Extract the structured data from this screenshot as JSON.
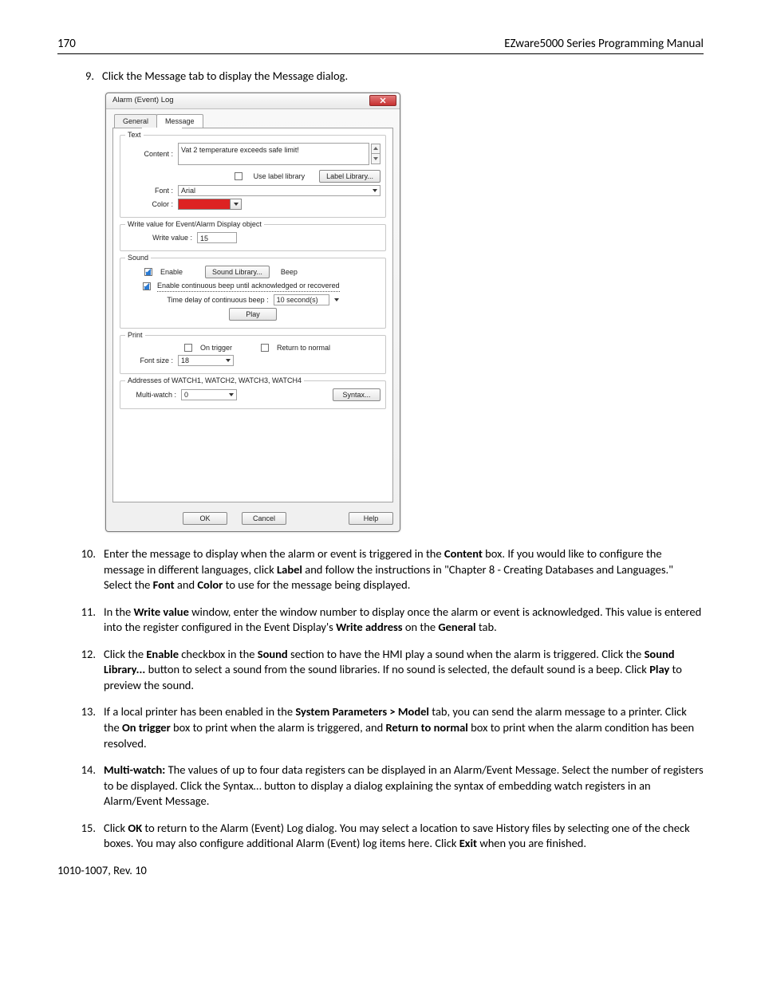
{
  "header": {
    "page": "170",
    "title": "EZware5000 Series Programming Manual"
  },
  "step9": {
    "num": "9.",
    "text": "Click the Message tab to display the Message dialog."
  },
  "dialog": {
    "title": "Alarm (Event) Log",
    "tab_general": "General",
    "tab_message": "Message",
    "text_group": "Text",
    "content_label": "Content :",
    "content_value": "Vat 2 temperature exceeds safe limit!",
    "use_label_library": "Use label library",
    "label_library_btn": "Label Library...",
    "font_label": "Font :",
    "font_value": "Arial",
    "color_label": "Color :",
    "write_group": "Write value for Event/Alarm Display object",
    "write_label": "Write value :",
    "write_value": "15",
    "sound_group": "Sound",
    "enable": "Enable",
    "sound_library_btn": "Sound Library...",
    "beep": "Beep",
    "cont_beep": "Enable continuous beep until acknowledged or recovered",
    "time_delay": "Time delay of continuous beep :",
    "time_value": "10  second(s)",
    "play_btn": "Play",
    "print_group": "Print",
    "on_trigger": "On trigger",
    "return_normal": "Return to normal",
    "fontsize_label": "Font size :",
    "fontsize_value": "18",
    "watch_group": "Addresses of WATCH1, WATCH2, WATCH3, WATCH4",
    "multi_label": "Multi-watch :",
    "multi_value": "0",
    "syntax_btn": "Syntax...",
    "ok": "OK",
    "cancel": "Cancel",
    "help": "Help"
  },
  "steps": {
    "s10": {
      "num": "10.",
      "p1": "Enter the message to display when the alarm or event is triggered in the ",
      "b1": "Content",
      "p2": " box. If you would like to configure the message in different languages, click ",
      "b2": "Label",
      "p3": " and follow the instructions in \"Chapter 8 - Creating Databases and Languages.\" Select the ",
      "b3": "Font",
      "p4": " and ",
      "b4": "Color",
      "p5": " to use for the message being displayed."
    },
    "s11": {
      "num": "11.",
      "p1": "In the ",
      "b1": "Write value",
      "p2": " window, enter the window number to display once the alarm or event is acknowledged. This value is entered into the register configured in the Event Display's ",
      "b2": "Write address",
      "p3": " on the ",
      "b3": "General",
      "p4": " tab."
    },
    "s12": {
      "num": "12.",
      "p1": "Click the ",
      "b1": "Enable",
      "p2": " checkbox in the ",
      "b2": "Sound",
      "p3": " section to have the HMI play a sound when the alarm is triggered. Click the ",
      "b3": "Sound Library...",
      "p4": " button to select a sound from the sound libraries. If no sound is selected, the default sound is a beep. Click ",
      "b4": "Play",
      "p5": " to preview the sound."
    },
    "s13": {
      "num": "13.",
      "p1": "If a local printer has been enabled in the ",
      "b1": "System Parameters > Model",
      "p2": " tab, you can send the alarm message to a printer. Click the ",
      "b2": "On trigger",
      "p3": " box to print when the alarm is triggered, and ",
      "b3": "Return to normal",
      "p4": " box to print when the alarm condition has been resolved."
    },
    "s14": {
      "num": "14.",
      "b1": "Multi-watch:",
      "p1": " The values of up to four data registers can be displayed in an Alarm/Event Message. Select the number of registers to be displayed. Click the Syntax… button to display a dialog explaining the syntax of embedding watch registers in an Alarm/Event Message."
    },
    "s15": {
      "num": "15.",
      "p1": "Click ",
      "b1": "OK",
      "p2": " to return to the Alarm (Event) Log dialog. You may select a location to save History files by selecting one of the check boxes. You may also configure additional Alarm (Event) log items here. Click ",
      "b2": "Exit",
      "p3": " when you are finished."
    }
  },
  "footer": "1010-1007, Rev. 10"
}
